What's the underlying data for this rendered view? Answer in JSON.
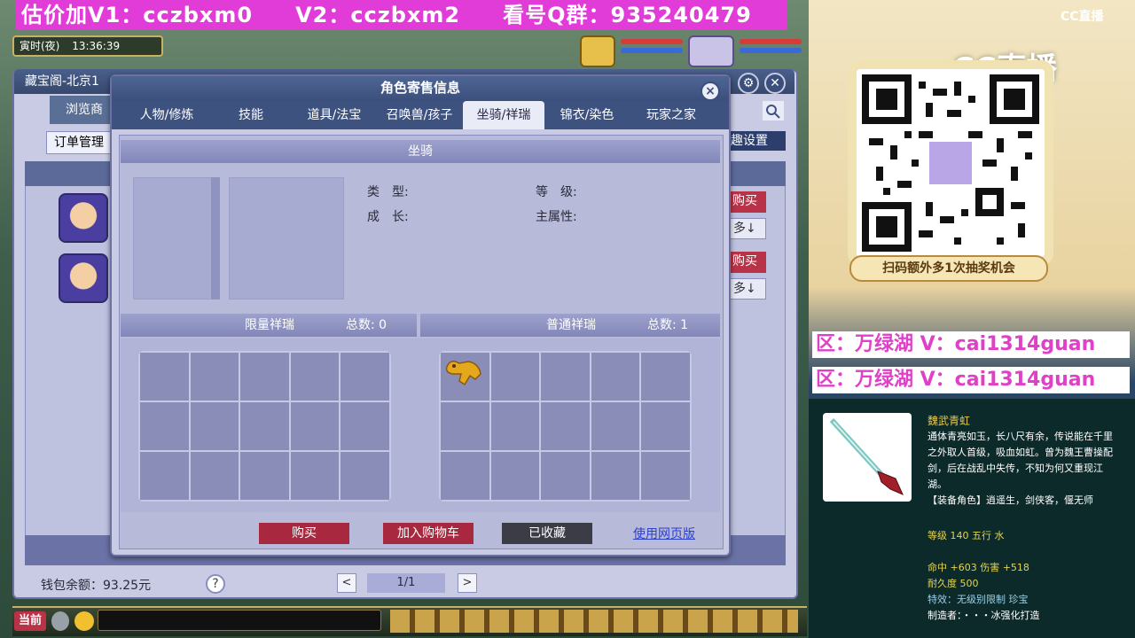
{
  "banner": {
    "v1": "估价加V1：cczbxm0",
    "v2": "V2：cczbxm2",
    "group": "看号Q群：935240479"
  },
  "hud": {
    "time_label": "寅时(夜)",
    "clock": "13:36:39"
  },
  "back_window": {
    "title": "藏宝阁-北京1",
    "browse_tab": "浏览商",
    "order_mgmt": "订单管理",
    "hobby_settings": "趣设置",
    "row_buy": "购买",
    "row_more": "多↓",
    "wallet": "钱包余额：93.25元",
    "help": "?",
    "page": "1/1",
    "prev": "<",
    "next": ">"
  },
  "modal": {
    "title": "角色寄售信息",
    "close": "×",
    "tabs": [
      "人物/修炼",
      "技能",
      "道具/法宝",
      "召唤兽/孩子",
      "坐骑/祥瑞",
      "锦衣/染色",
      "玩家之家"
    ],
    "active_tab": 4,
    "mount_section": "坐骑",
    "fields": {
      "type_label": "类　型:",
      "level_label": "等　级:",
      "growth_label": "成　长:",
      "main_attr_label": "主属性:"
    },
    "limited": {
      "label": "限量祥瑞",
      "total_label": "总数: 0"
    },
    "normal": {
      "label": "普通祥瑞",
      "total_label": "总数: 1"
    },
    "buttons": {
      "buy": "购买",
      "add_cart": "加入购物车",
      "favorited": "已收藏",
      "web_link": "使用网页版"
    }
  },
  "bottom_hud": {
    "current": "当前"
  },
  "right_panel": {
    "cc_logo": "CC直播",
    "cc_big": "CC直播",
    "qr_caption": "扫码额外多1次抽奖机会",
    "zone_line_1": "区：万绿湖 V：cai1314guan",
    "zone_line_2": "区：万绿湖 V：cai1314guan",
    "weapon": {
      "name": "魏武青虹",
      "desc": "通体青亮如玉，长八尺有余，传说能在千里之外取人首级，吸血如虹。曾为魏王曹操配剑，后在战乱中失传，不知为何又重现江湖。",
      "equip": "【装备角色】逍遥生，剑侠客，偃无师",
      "level_line": "等级 140  五行 水",
      "hit_line": "命中 +603  伤害 +518",
      "durability": "耐久度 500",
      "special": "特效：无级别限制 珍宝",
      "maker": "制造者：・・・冰强化打造"
    }
  },
  "colors": {
    "banner_bg": "#e13cd8",
    "zone_text": "#e040c8",
    "buy_red": "#a8293f",
    "tab_bar": "#3e5280",
    "link_blue": "#2b3fd0"
  }
}
